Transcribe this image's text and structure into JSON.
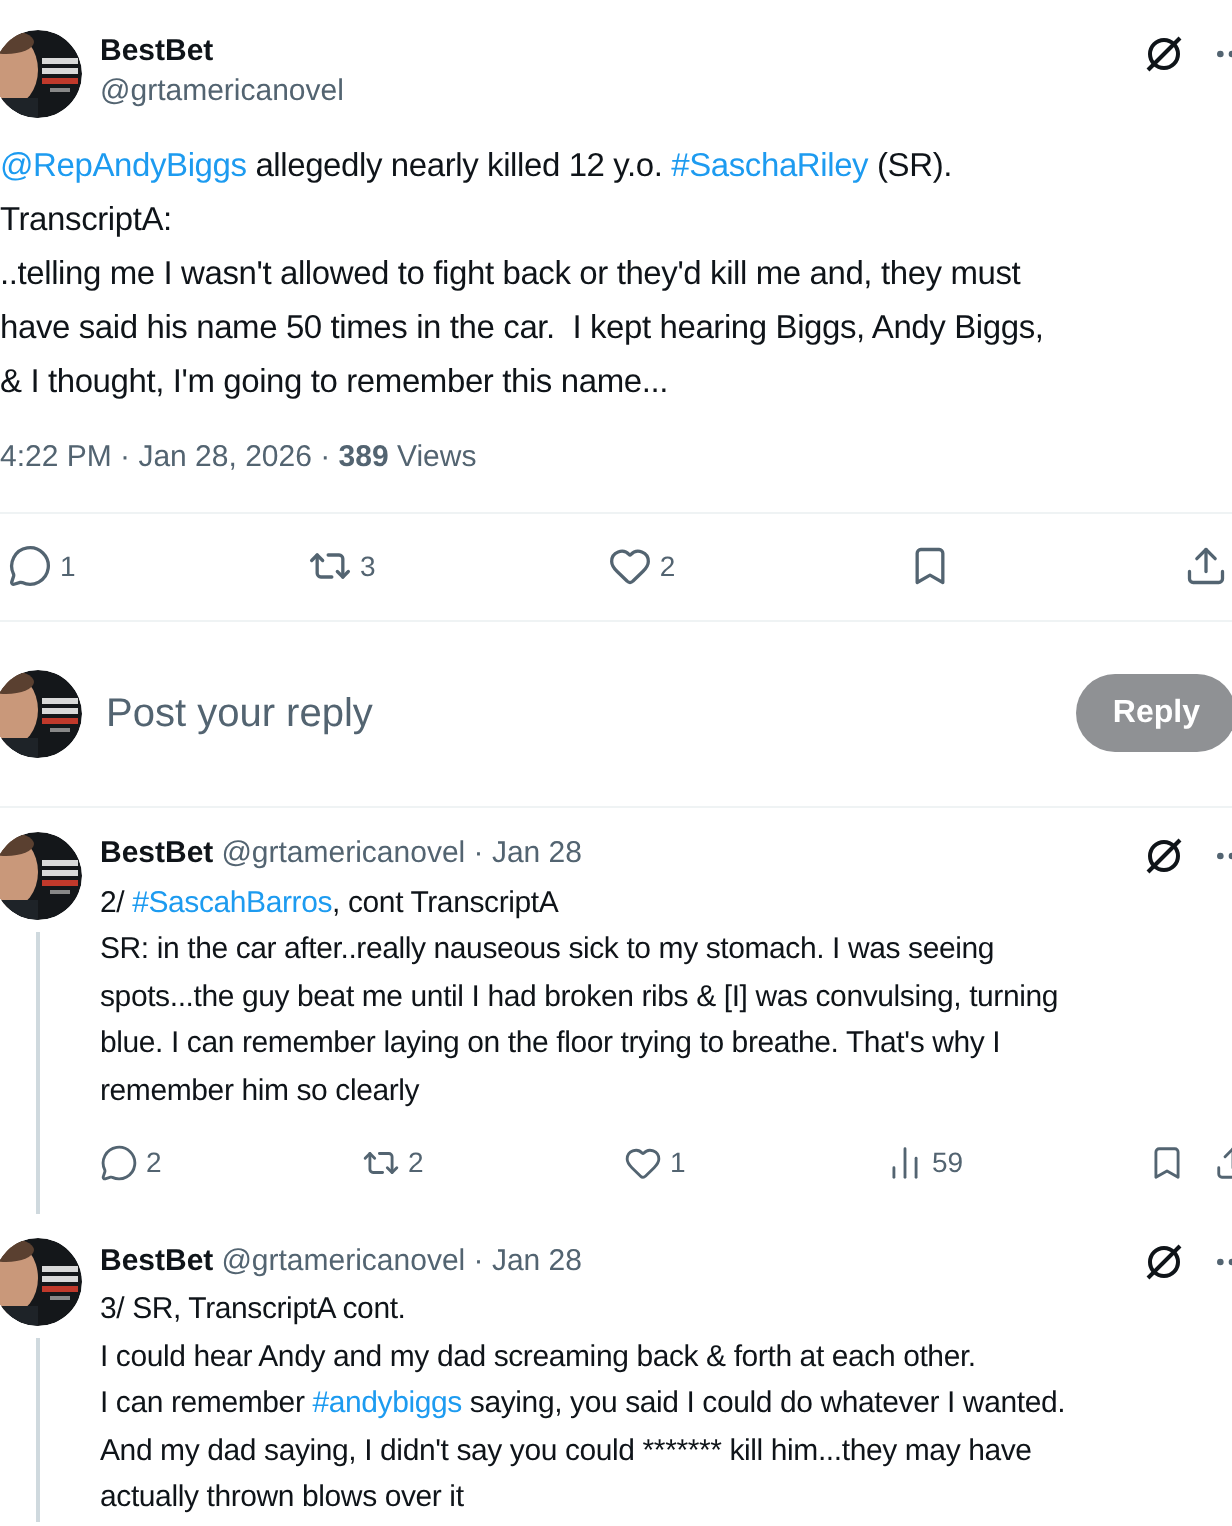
{
  "post": {
    "author": {
      "name": "BestBet",
      "handle": "@grtamericanovel"
    },
    "lines": [
      [
        {
          "kind": "mention",
          "text": "@RepAndyBiggs"
        },
        {
          "kind": "text",
          "text": " allegedly nearly killed 12 y.o. "
        },
        {
          "kind": "hashtag",
          "text": "#SaschaRiley"
        },
        {
          "kind": "text",
          "text": " (SR)."
        }
      ],
      [
        {
          "kind": "text",
          "text": "TranscriptA:"
        }
      ],
      [
        {
          "kind": "text",
          "text": "..telling me I wasn't allowed to fight back or they'd kill me and, they must"
        }
      ],
      [
        {
          "kind": "text",
          "text": "have said his name 50 times in the car.  I kept hearing Biggs, Andy Biggs,"
        }
      ],
      [
        {
          "kind": "text",
          "text": "& I thought, I'm going to remember this name..."
        }
      ]
    ],
    "meta": "4:22 PM · Jan 28, 2026 · **389** Views",
    "actions": [
      {
        "kind": "reply",
        "count": "1"
      },
      {
        "kind": "repost",
        "count": "3"
      },
      {
        "kind": "like",
        "count": "2"
      },
      {
        "kind": "bookmark"
      },
      {
        "kind": "share"
      }
    ]
  },
  "composer": {
    "placeholder": "Post your reply",
    "button": {
      "label": "Reply",
      "disabled": true
    }
  },
  "replies": [
    {
      "name": "BestBet",
      "meta": "@grtamericanovel · Jan 28",
      "thread": true,
      "lines": [
        [
          {
            "kind": "text",
            "text": "2/ "
          },
          {
            "kind": "hashtag",
            "text": "#SascahBarros"
          },
          {
            "kind": "text",
            "text": ", cont TranscriptA"
          }
        ],
        [
          {
            "kind": "text",
            "text": "SR: in the car after..really nauseous sick to my stomach. I was seeing"
          }
        ],
        [
          {
            "kind": "text",
            "text": "spots...the guy beat me until I had broken ribs & [I] was convulsing, turning"
          }
        ],
        [
          {
            "kind": "text",
            "text": "blue. I can remember laying on the floor trying to breathe. That's why I"
          }
        ],
        [
          {
            "kind": "text",
            "text": "remember him so clearly"
          }
        ]
      ],
      "actions": [
        {
          "kind": "reply",
          "count": "2"
        },
        {
          "kind": "repost",
          "count": "2"
        },
        {
          "kind": "like",
          "count": "1"
        },
        {
          "kind": "views",
          "count": "59"
        },
        {
          "kind": "bookmark"
        },
        {
          "kind": "share"
        }
      ]
    },
    {
      "name": "BestBet",
      "meta": "@grtamericanovel · Jan 28",
      "thread": true,
      "lines": [
        [
          {
            "kind": "text",
            "text": "3/ SR, TranscriptA cont."
          }
        ],
        [
          {
            "kind": "text",
            "text": "I could hear Andy and my dad screaming back & forth at each other."
          }
        ],
        [
          {
            "kind": "text",
            "text": "I can remember "
          },
          {
            "kind": "hashtag",
            "text": "#andybiggs"
          },
          {
            "kind": "text",
            "text": " saying, you said I could do whatever I wanted."
          }
        ],
        [
          {
            "kind": "text",
            "text": "And my dad saying, I didn't say you could ******* kill him...they may have"
          }
        ],
        [
          {
            "kind": "text",
            "text": "actually thrown blows over it"
          }
        ]
      ]
    }
  ]
}
